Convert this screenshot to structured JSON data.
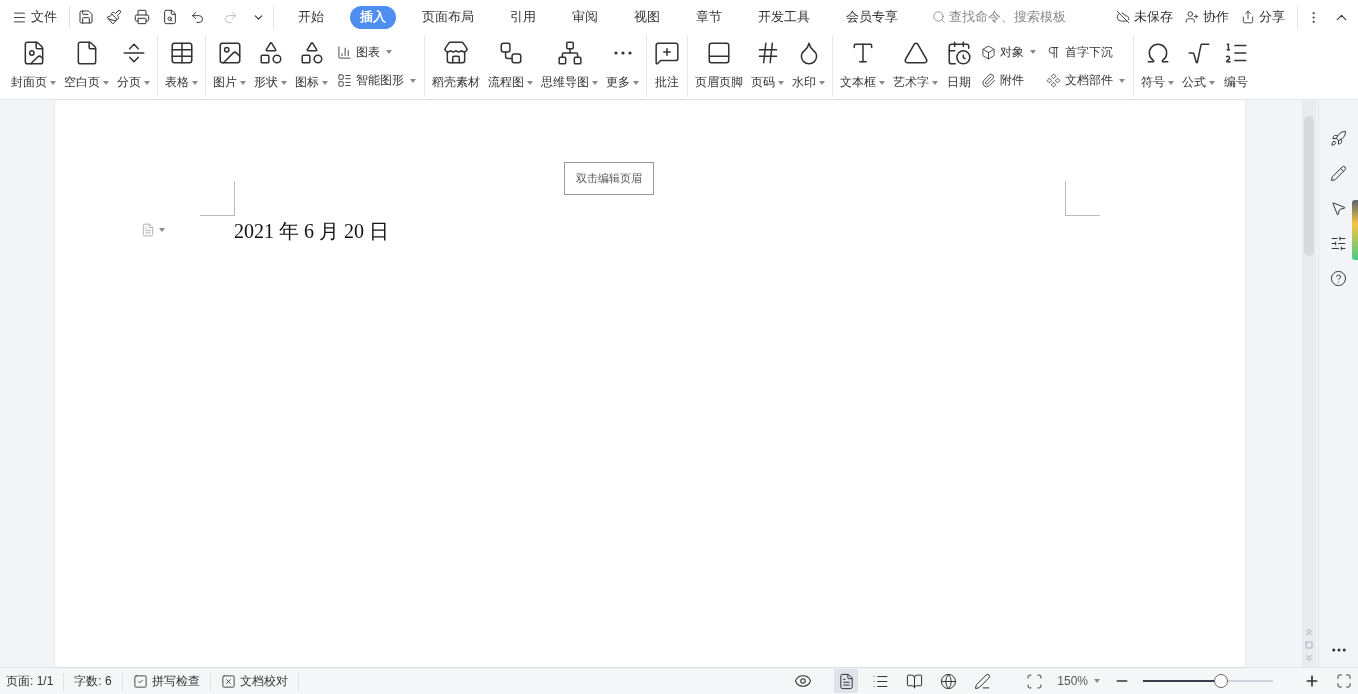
{
  "menu": {
    "label": "文件"
  },
  "tabs": [
    {
      "label": "开始",
      "selected": false
    },
    {
      "label": "插入",
      "selected": true
    },
    {
      "label": "页面布局",
      "selected": false
    },
    {
      "label": "引用",
      "selected": false
    },
    {
      "label": "审阅",
      "selected": false
    },
    {
      "label": "视图",
      "selected": false
    },
    {
      "label": "章节",
      "selected": false
    },
    {
      "label": "开发工具",
      "selected": false
    },
    {
      "label": "会员专享",
      "selected": false
    }
  ],
  "search": {
    "placeholder": "查找命令、搜索模板"
  },
  "top_actions": [
    {
      "label": "未保存"
    },
    {
      "label": "协作"
    },
    {
      "label": "分享"
    }
  ],
  "ribbon": {
    "groups": [
      {
        "items": [
          {
            "kind": "large",
            "label": "封面页",
            "dropdown": true
          },
          {
            "kind": "large",
            "label": "空白页",
            "dropdown": true
          },
          {
            "kind": "large",
            "label": "分页",
            "dropdown": true
          }
        ]
      },
      {
        "items": [
          {
            "kind": "large",
            "label": "表格",
            "dropdown": true
          }
        ]
      },
      {
        "items": [
          {
            "kind": "large",
            "label": "图片",
            "dropdown": true
          },
          {
            "kind": "large",
            "label": "形状",
            "dropdown": true
          },
          {
            "kind": "large",
            "label": "图标",
            "dropdown": true
          },
          {
            "kind": "stack",
            "items": [
              {
                "label": "图表",
                "dropdown": true
              },
              {
                "label": "智能图形",
                "dropdown": true
              }
            ]
          }
        ]
      },
      {
        "items": [
          {
            "kind": "large",
            "label": "稻壳素材",
            "dropdown": false
          },
          {
            "kind": "large",
            "label": "流程图",
            "dropdown": true
          },
          {
            "kind": "large",
            "label": "思维导图",
            "dropdown": true
          },
          {
            "kind": "large",
            "label": "更多",
            "dropdown": true
          }
        ]
      },
      {
        "items": [
          {
            "kind": "large",
            "label": "批注",
            "dropdown": false
          }
        ]
      },
      {
        "items": [
          {
            "kind": "large",
            "label": "页眉页脚",
            "dropdown": false
          },
          {
            "kind": "large",
            "label": "页码",
            "dropdown": true
          },
          {
            "kind": "large",
            "label": "水印",
            "dropdown": true
          }
        ]
      },
      {
        "items": [
          {
            "kind": "large",
            "label": "文本框",
            "dropdown": true
          },
          {
            "kind": "large",
            "label": "艺术字",
            "dropdown": true
          },
          {
            "kind": "large",
            "label": "日期",
            "dropdown": false
          },
          {
            "kind": "stack",
            "items": [
              {
                "label": "对象",
                "dropdown": true
              },
              {
                "label": "附件",
                "dropdown": false
              }
            ]
          },
          {
            "kind": "stack",
            "items": [
              {
                "label": "首字下沉",
                "dropdown": false
              },
              {
                "label": "文档部件",
                "dropdown": true
              }
            ]
          }
        ]
      },
      {
        "items": [
          {
            "kind": "large",
            "label": "符号",
            "dropdown": true
          },
          {
            "kind": "large",
            "label": "公式",
            "dropdown": true
          },
          {
            "kind": "large",
            "label": "编号",
            "dropdown": false
          }
        ]
      }
    ]
  },
  "document": {
    "header_hint": "双击编辑页眉",
    "text": "2021 年 6 月 20 日"
  },
  "status_bar": {
    "items": [
      {
        "kind": "text",
        "label": "页面: 1/1"
      },
      {
        "kind": "text",
        "label": "字数: 6"
      },
      {
        "kind": "check",
        "label": "拼写检查"
      },
      {
        "kind": "check",
        "label": "文档校对"
      }
    ],
    "views": [
      {
        "selected": true
      },
      {
        "selected": false
      },
      {
        "selected": false
      },
      {
        "selected": false
      },
      {
        "selected": false
      }
    ],
    "zoom": {
      "label": "150%",
      "level": 0.58
    }
  }
}
